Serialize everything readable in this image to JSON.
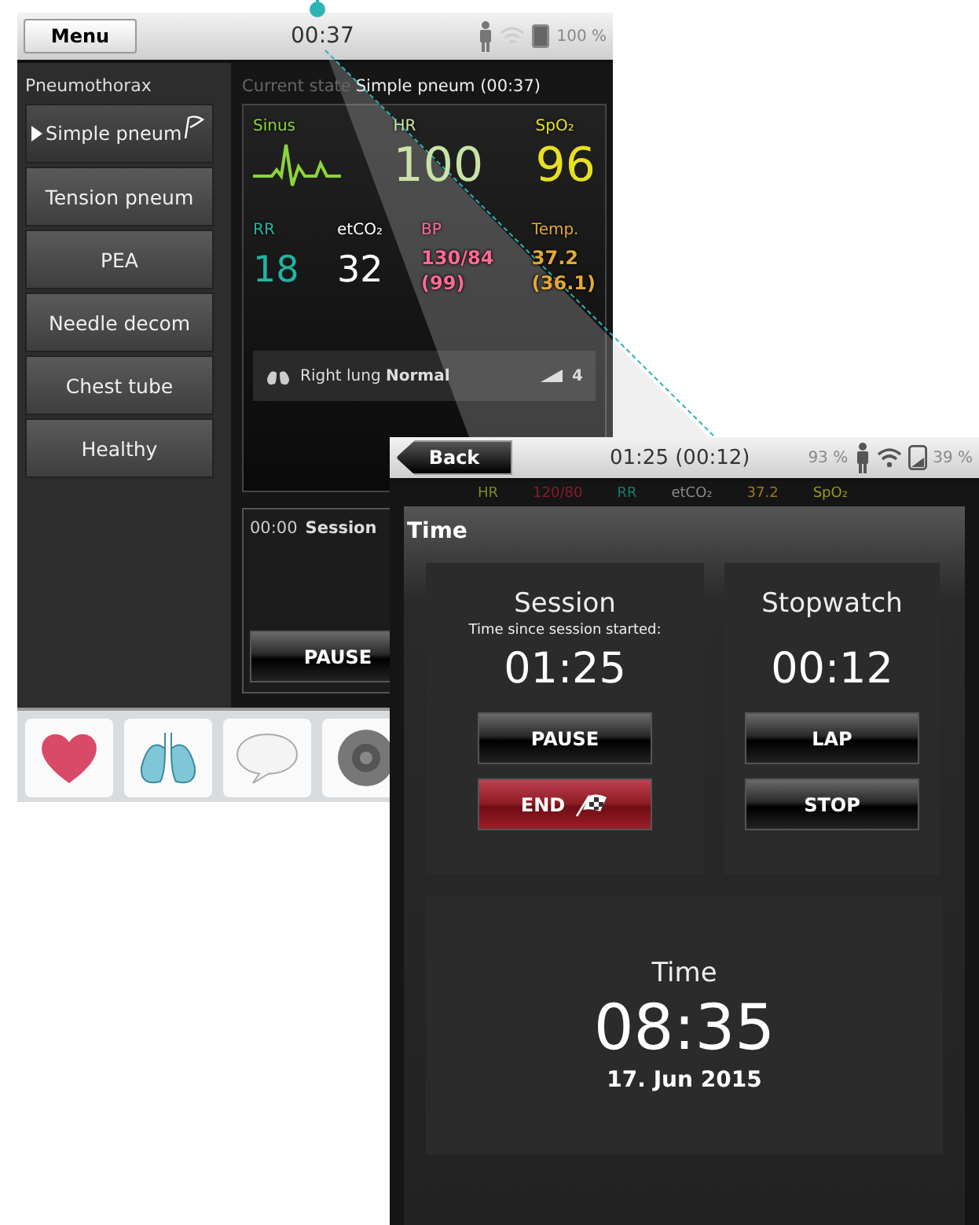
{
  "back_screen": {
    "top_bar": {
      "menu_button": "Menu",
      "clock": "00:37",
      "battery": "100 %"
    },
    "scenario": {
      "title": "Pneumothorax",
      "items": [
        {
          "label": "Simple pneum",
          "selected": true
        },
        {
          "label": "Tension pneum",
          "selected": false
        },
        {
          "label": "PEA",
          "selected": false
        },
        {
          "label": "Needle decom",
          "selected": false
        },
        {
          "label": "Chest tube",
          "selected": false
        },
        {
          "label": "Healthy",
          "selected": false
        }
      ]
    },
    "current_state": {
      "label": "Current state",
      "value": "Simple pneum (00:37)"
    },
    "vital_rows": [
      [
        {
          "kind": "wave",
          "label": "Sinus",
          "color": "#8cd43c"
        },
        {
          "kind": "value",
          "label": "HR",
          "lines": [
            "100"
          ],
          "color": "#c9e3a6"
        },
        {
          "kind": "value",
          "label": "SpO₂",
          "lines": [
            "96"
          ],
          "color": "#e6e021"
        }
      ],
      [
        {
          "kind": "value",
          "label": "RR",
          "lines": [
            "18"
          ],
          "color": "#22b3a3"
        },
        {
          "kind": "value",
          "label": "etCO₂",
          "lines": [
            "32"
          ],
          "color": "#ffffff"
        },
        {
          "kind": "pair",
          "label": "BP",
          "lines": [
            "130/84",
            "(99)"
          ],
          "color": "#ff6a96"
        },
        {
          "kind": "pair",
          "label": "Temp.",
          "lines": [
            "37.2",
            "(36.1)"
          ],
          "color": "#e3a936"
        }
      ]
    ],
    "lung_status": {
      "text": "Right lung **Normal**",
      "count": "4"
    },
    "log": {
      "time": "00:00",
      "text": "Session"
    },
    "pause_button": "PAUSE"
  },
  "front_screen": {
    "top_bar": {
      "back_button": "Back",
      "clock": "01:25 (00:12)",
      "battery_a": "93 %",
      "battery_b": "39 %"
    },
    "background_vitals": [
      {
        "text": "HR",
        "color": "#7a8a2a"
      },
      {
        "text": "120/80",
        "color": "#8a1a2a"
      },
      {
        "text": "RR",
        "color": "#1a7a6a"
      },
      {
        "text": "etCO₂",
        "color": "#8a8a8a"
      },
      {
        "text": "37.2",
        "color": "#9a7a1a"
      },
      {
        "text": "SpO₂",
        "color": "#9a9a1a"
      }
    ],
    "dialog": {
      "title": "Time",
      "session": {
        "title": "Session",
        "subtitle": "Time since session started:",
        "time": "01:25",
        "buttons": [
          {
            "label": "PAUSE",
            "kind": "normal"
          },
          {
            "label": "END",
            "kind": "danger"
          }
        ]
      },
      "stopwatch": {
        "title": "Stopwatch",
        "time": "00:12",
        "buttons": [
          {
            "label": "LAP",
            "kind": "normal"
          },
          {
            "label": "STOP",
            "kind": "normal"
          }
        ]
      },
      "clock": {
        "title": "Time",
        "time": "08:35",
        "date": "17. Jun 2015"
      }
    }
  }
}
